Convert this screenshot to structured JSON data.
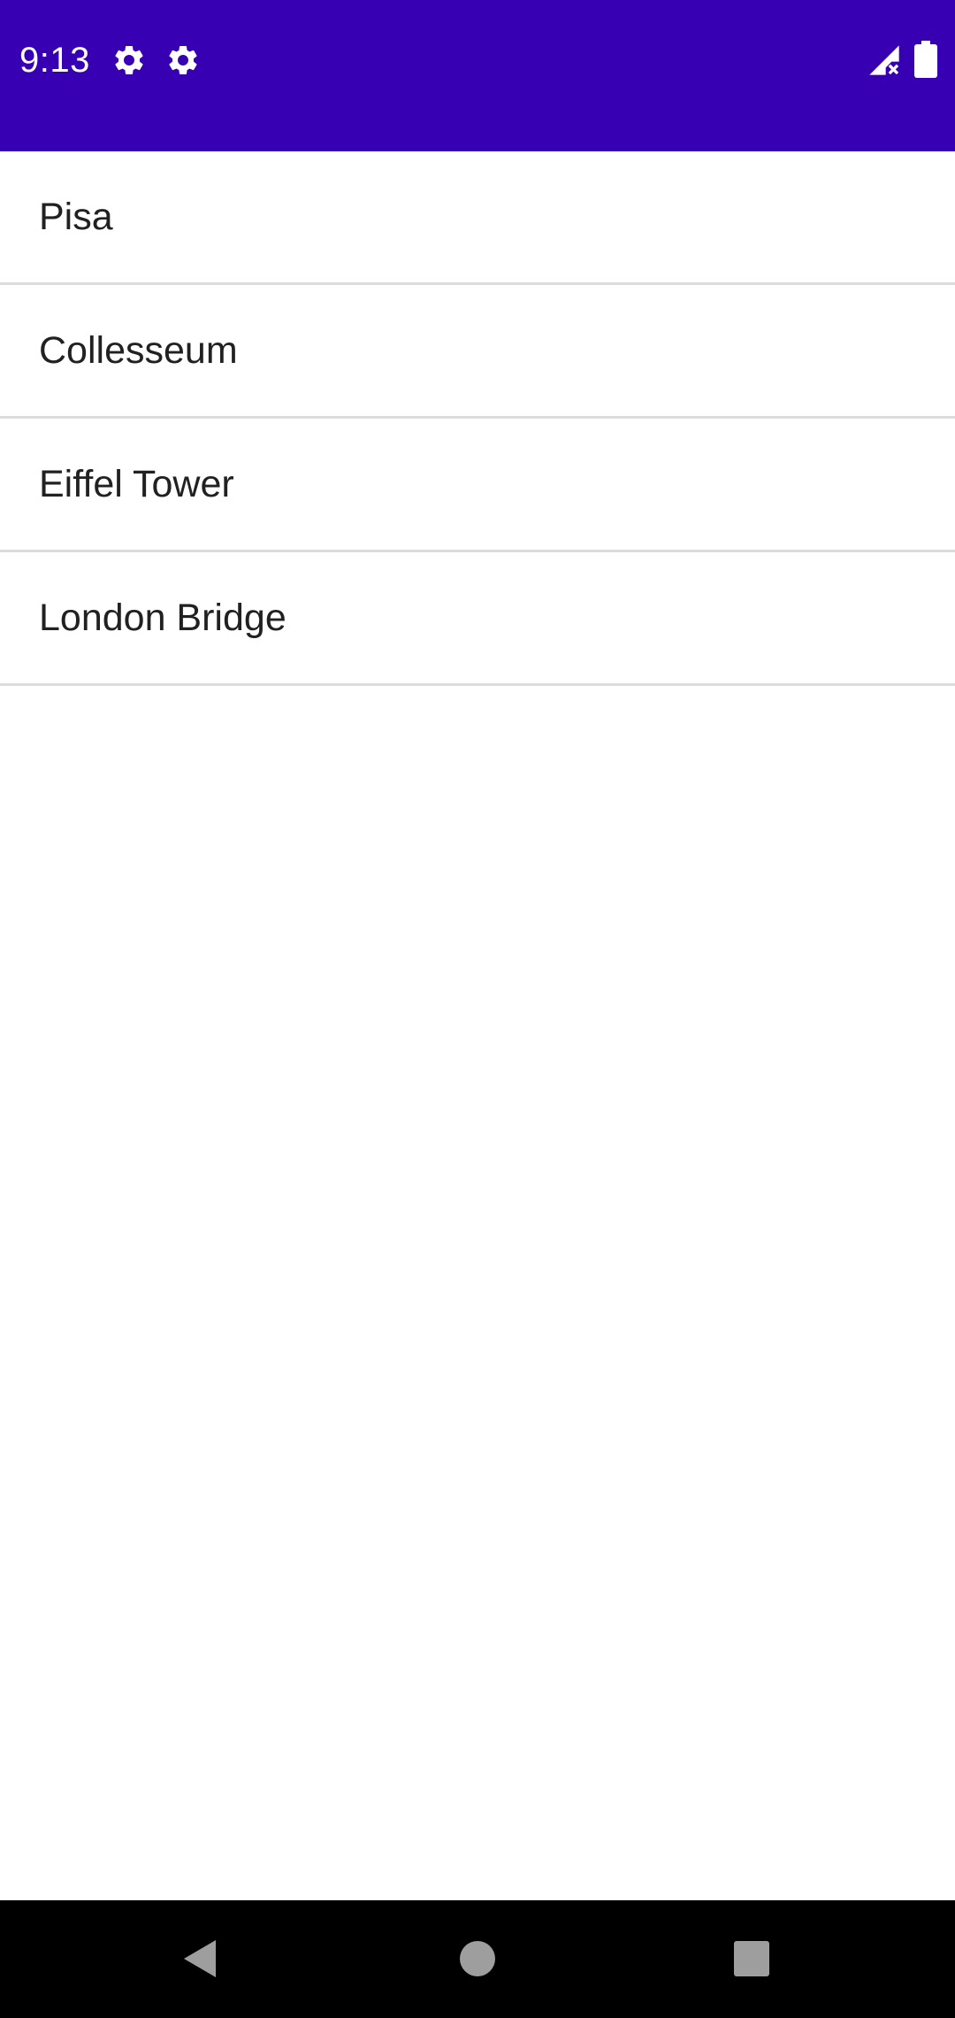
{
  "status_bar": {
    "time": "9:13",
    "background_color": "#3700b3",
    "left_icons": [
      "settings-icon",
      "settings-icon"
    ],
    "right_icons": [
      "signal-no-service-icon",
      "battery-full-icon"
    ]
  },
  "list": {
    "items": [
      {
        "label": "Pisa"
      },
      {
        "label": "Collesseum"
      },
      {
        "label": "Eiffel Tower"
      },
      {
        "label": "London Bridge"
      }
    ],
    "divider_color": "#dcdcdc",
    "text_color": "#212121"
  },
  "nav_bar": {
    "background_color": "#000000",
    "buttons": [
      "back-icon",
      "home-icon",
      "recents-icon"
    ],
    "icon_color": "#9e9e9e"
  }
}
